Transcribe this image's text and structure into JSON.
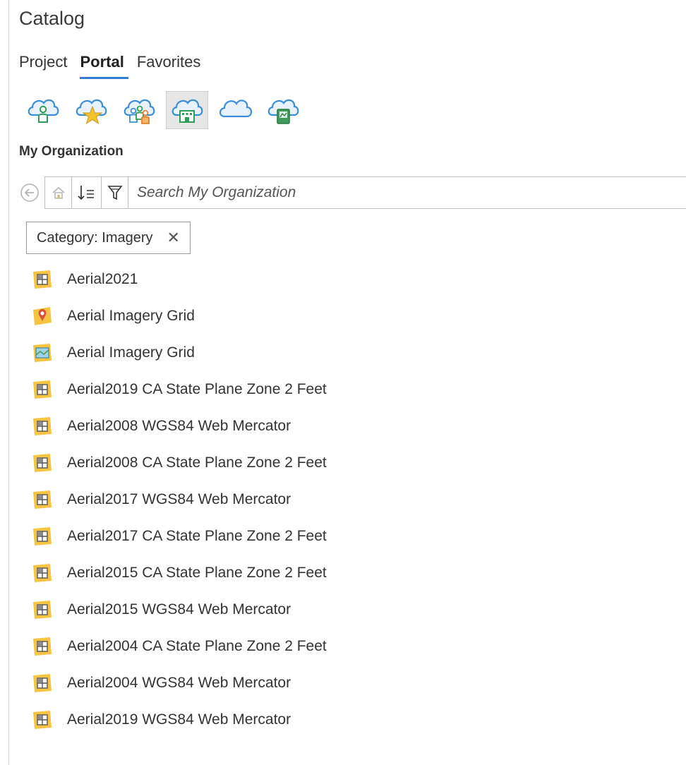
{
  "pane": {
    "title": "Catalog"
  },
  "tabs": [
    {
      "label": "Project",
      "active": false
    },
    {
      "label": "Portal",
      "active": true
    },
    {
      "label": "Favorites",
      "active": false
    }
  ],
  "portal_icons": [
    {
      "icon": "my-content-cloud-icon",
      "selected": false
    },
    {
      "icon": "my-favorites-cloud-icon",
      "selected": false
    },
    {
      "icon": "my-groups-cloud-icon",
      "selected": false
    },
    {
      "icon": "my-organization-cloud-icon",
      "selected": true
    },
    {
      "icon": "arcgis-online-cloud-icon",
      "selected": false
    },
    {
      "icon": "living-atlas-cloud-icon",
      "selected": false
    }
  ],
  "section": {
    "label": "My Organization"
  },
  "search": {
    "placeholder": "Search My Organization"
  },
  "filter_chip": {
    "label": "Category: Imagery",
    "close_glyph": "✕"
  },
  "items": [
    {
      "label": "Aerial2021",
      "icon": "imagery-layer-icon"
    },
    {
      "label": "Aerial Imagery Grid",
      "icon": "web-map-icon"
    },
    {
      "label": "Aerial Imagery Grid",
      "icon": "feature-layer-icon"
    },
    {
      "label": "Aerial2019 CA State Plane Zone 2 Feet",
      "icon": "imagery-layer-icon"
    },
    {
      "label": "Aerial2008 WGS84 Web Mercator",
      "icon": "imagery-layer-icon"
    },
    {
      "label": "Aerial2008 CA State Plane Zone 2 Feet",
      "icon": "imagery-layer-icon"
    },
    {
      "label": "Aerial2017 WGS84 Web Mercator",
      "icon": "imagery-layer-icon"
    },
    {
      "label": "Aerial2017 CA State Plane Zone 2 Feet",
      "icon": "imagery-layer-icon"
    },
    {
      "label": "Aerial2015 CA State Plane Zone 2 Feet",
      "icon": "imagery-layer-icon"
    },
    {
      "label": "Aerial2015 WGS84 Web Mercator",
      "icon": "imagery-layer-icon"
    },
    {
      "label": "Aerial2004 CA State Plane Zone 2 Feet",
      "icon": "imagery-layer-icon"
    },
    {
      "label": "Aerial2004 WGS84 Web Mercator",
      "icon": "imagery-layer-icon"
    },
    {
      "label": "Aerial2019 WGS84 Web Mercator",
      "icon": "imagery-layer-icon"
    }
  ],
  "colors": {
    "accent": "#2f7bd6",
    "cloud": "#3b8fd9",
    "item_folder": "#f5c542"
  }
}
